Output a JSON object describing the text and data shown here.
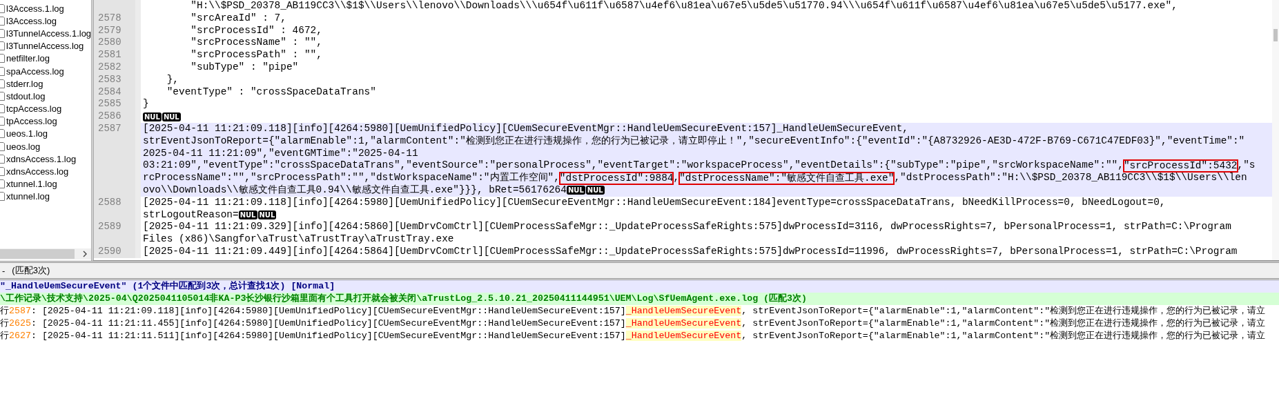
{
  "file_list": {
    "items": [
      "l3Access.1.log",
      "l3Access.log",
      "l3TunnelAccess.1.log",
      "l3TunnelAccess.log",
      "netfilter.log",
      "spaAccess.log",
      "stderr.log",
      "stdout.log",
      "tcpAccess.log",
      "tpAccess.log",
      "ueos.1.log",
      "ueos.log",
      "xdnsAccess.1.log",
      "xdnsAccess.log",
      "xtunnel.1.log",
      "xtunnel.log"
    ]
  },
  "editor": {
    "lines": [
      {
        "selected": false,
        "rows": [
          {
            "segments": [
              {
                "kind": "text",
                "text": "        \"H:\\\\$PSD_20378_AB119CC3\\\\$1$\\\\Users\\\\lenovo\\\\Downloads\\\\\\u654f\\u611f\\u6587\\u4ef6\\u81ea\\u67e5\\u5de5\\u51770.94\\\\\\u654f\\u611f\\u6587\\u4ef6\\u81ea\\u67e5\\u5de5\\u5177.exe\","
              }
            ]
          }
        ]
      },
      {
        "number": "2578",
        "selected": false,
        "rows": [
          {
            "segments": [
              {
                "kind": "text",
                "text": "        \"srcAreaId\" : 7,"
              }
            ]
          }
        ]
      },
      {
        "number": "2579",
        "selected": false,
        "rows": [
          {
            "segments": [
              {
                "kind": "text",
                "text": "        \"srcProcessId\" : 4672,"
              }
            ]
          }
        ]
      },
      {
        "number": "2580",
        "selected": false,
        "rows": [
          {
            "segments": [
              {
                "kind": "text",
                "text": "        \"srcProcessName\" : \"\","
              }
            ]
          }
        ]
      },
      {
        "number": "2581",
        "selected": false,
        "rows": [
          {
            "segments": [
              {
                "kind": "text",
                "text": "        \"srcProcessPath\" : \"\","
              }
            ]
          }
        ]
      },
      {
        "number": "2582",
        "selected": false,
        "rows": [
          {
            "segments": [
              {
                "kind": "text",
                "text": "        \"subType\" : \"pipe\""
              }
            ]
          }
        ]
      },
      {
        "number": "2583",
        "selected": false,
        "rows": [
          {
            "segments": [
              {
                "kind": "text",
                "text": "    },"
              }
            ]
          }
        ]
      },
      {
        "number": "2584",
        "selected": false,
        "rows": [
          {
            "segments": [
              {
                "kind": "text",
                "text": "    \"eventType\" : \"crossSpaceDataTrans\""
              }
            ]
          }
        ]
      },
      {
        "number": "2585",
        "selected": false,
        "rows": [
          {
            "segments": [
              {
                "kind": "text",
                "text": "}"
              }
            ]
          }
        ]
      },
      {
        "number": "2586",
        "selected": false,
        "rows": [
          {
            "segments": [
              {
                "kind": "nul",
                "text": "NUL"
              },
              {
                "kind": "nul",
                "text": "NUL"
              }
            ]
          }
        ]
      },
      {
        "number": "2587",
        "selected": true,
        "rows": [
          {
            "segments": [
              {
                "kind": "text",
                "text": "[2025-04-11 11:21:09.118][info][4264:5980][UemUnifiedPolicy][CUemSecureEventMgr::HandleUemSecureEvent:157]_HandleUemSecureEvent,"
              }
            ]
          },
          {
            "segments": [
              {
                "kind": "text",
                "text": "strEventJsonToReport={\"alarmEnable\":1,\"alarmContent\":\"检测到您正在进行违规操作，您的行为已被记录，请立即停止！\",\"secureEventInfo\":{\"eventId\":\"{A8732926-AE3D-472F-B769-C671C47EDF03}\",\"eventTime\":\""
              }
            ]
          },
          {
            "segments": [
              {
                "kind": "text",
                "text": "2025-04-11 11:21:09\",\"eventGMTime\":\"2025-04-11"
              }
            ]
          },
          {
            "segments": [
              {
                "kind": "text",
                "text": "03:21:09\",\"eventType\":\"crossSpaceDataTrans\",\"eventSource\":\"personalProcess\",\"eventTarget\":\"workspaceProcess\",\"eventDetails\":{\"subType\":\"pipe\",\"srcWorkspaceName\":\"\","
              },
              {
                "kind": "boxed",
                "text": "\"srcProcessId\":5432"
              },
              {
                "kind": "text",
                "text": ",\"s"
              }
            ]
          },
          {
            "segments": [
              {
                "kind": "text",
                "text": "rcProcessName\":\"\",\"srcProcessPath\":\"\",\"dstWorkspaceName\":\"内置工作空间\","
              },
              {
                "kind": "boxed",
                "text": "\"dstProcessId\":9884"
              },
              {
                "kind": "text",
                "text": ","
              },
              {
                "kind": "boxed",
                "text": "\"dstProcessName\":\"敏感文件自查工具.exe\""
              },
              {
                "kind": "text",
                "text": ",\"dstProcessPath\":\"H:\\\\$PSD_20378_AB119CC3\\\\$1$\\\\Users\\\\len"
              }
            ]
          },
          {
            "segments": [
              {
                "kind": "text",
                "text": "ovo\\\\Downloads\\\\敏感文件自查工具0.94\\\\敏感文件自查工具.exe\"}}}, bRet=56176264"
              },
              {
                "kind": "nul",
                "text": "NUL"
              },
              {
                "kind": "nul",
                "text": "NUL"
              }
            ]
          }
        ]
      },
      {
        "number": "2588",
        "selected": false,
        "rows": [
          {
            "segments": [
              {
                "kind": "text",
                "text": "[2025-04-11 11:21:09.118][info][4264:5980][UemUnifiedPolicy][CUemSecureEventMgr::HandleUemSecureEvent:184]eventType=crossSpaceDataTrans, bNeedKillProcess=0, bNeedLogout=0,"
              }
            ]
          },
          {
            "segments": [
              {
                "kind": "text",
                "text": "strLogoutReason="
              },
              {
                "kind": "nul",
                "text": "NUL"
              },
              {
                "kind": "nul",
                "text": "NUL"
              }
            ]
          }
        ]
      },
      {
        "number": "2589",
        "selected": false,
        "rows": [
          {
            "segments": [
              {
                "kind": "text",
                "text": "[2025-04-11 11:21:09.329][info][4264:5860][UemDrvComCtrl][CUemProcessSafeMgr::_UpdateProcessSafeRights:575]dwProcessId=3116, dwProcessRights=7, bPersonalProcess=1, strPath=C:\\Program"
              }
            ]
          },
          {
            "segments": [
              {
                "kind": "text",
                "text": "Files (x86)\\Sangfor\\aTrust\\aTrustTray\\aTrustTray.exe"
              }
            ]
          }
        ]
      },
      {
        "number": "2590",
        "selected": false,
        "rows": [
          {
            "segments": [
              {
                "kind": "text",
                "text": "[2025-04-11 11:21:09.449][info][4264:5864][UemDrvComCtrl][CUemProcessSafeMgr::_UpdateProcessSafeRights:575]dwProcessId=11996, dwProcessRights=7, bPersonalProcess=1, strPath=C:\\Program"
              }
            ]
          }
        ]
      }
    ]
  },
  "results": {
    "collapse": "-",
    "summary": "(匹配3次)",
    "search": "\"_HandleUemSecureEvent\" (1个文件中匹配到3次，总计查找1次) [Normal]",
    "file": {
      "path": "\\工作记录\\技术支持\\2025-04\\Q2025041105014非KA-P3长沙银行沙箱里面有个工具打开就会被关闭\\aTrustLog_2.5.10.21_20250411144951\\UEM\\Log\\SfUemAgent.exe.log",
      "count": "(匹配3次)"
    },
    "hits": [
      {
        "prefix": "行",
        "line": "2587",
        "before": ": [2025-04-11 11:21:09.118][info][4264:5980][UemUnifiedPolicy][CUemSecureEventMgr::HandleUemSecureEvent:157]",
        "match": "_HandleUemSecureEvent",
        "after": ", strEventJsonToReport={\"alarmEnable\":1,\"alarmContent\":\"检测到您正在进行违规操作，您的行为已被记录，请立"
      },
      {
        "prefix": "行",
        "line": "2625",
        "before": ": [2025-04-11 11:21:11.455][info][4264:5980][UemUnifiedPolicy][CUemSecureEventMgr::HandleUemSecureEvent:157]",
        "match": "_HandleUemSecureEvent",
        "after": ", strEventJsonToReport={\"alarmEnable\":1,\"alarmContent\":\"检测到您正在进行违规操作，您的行为已被记录，请立"
      },
      {
        "prefix": "行",
        "line": "2627",
        "before": ": [2025-04-11 11:21:11.511][info][4264:5980][UemUnifiedPolicy][CUemSecureEventMgr::HandleUemSecureEvent:157]",
        "match": "_HandleUemSecureEvent",
        "after": ", strEventJsonToReport={\"alarmEnable\":1,\"alarmContent\":\"检测到您正在进行违规操作，您的行为已被记录，请立"
      }
    ]
  }
}
